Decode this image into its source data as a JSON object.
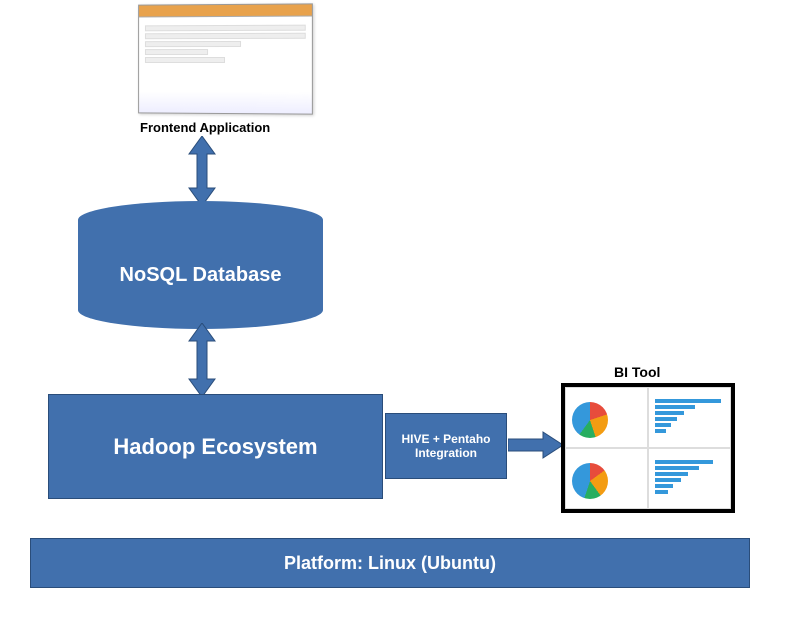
{
  "frontend": {
    "label": "Frontend Application"
  },
  "nosql": {
    "label": "NoSQL Database"
  },
  "hadoop": {
    "label": "Hadoop Ecosystem"
  },
  "hive": {
    "label": "HIVE + Pentaho Integration"
  },
  "bi": {
    "label": "BI Tool"
  },
  "platform": {
    "label": "Platform: Linux (Ubuntu)"
  }
}
